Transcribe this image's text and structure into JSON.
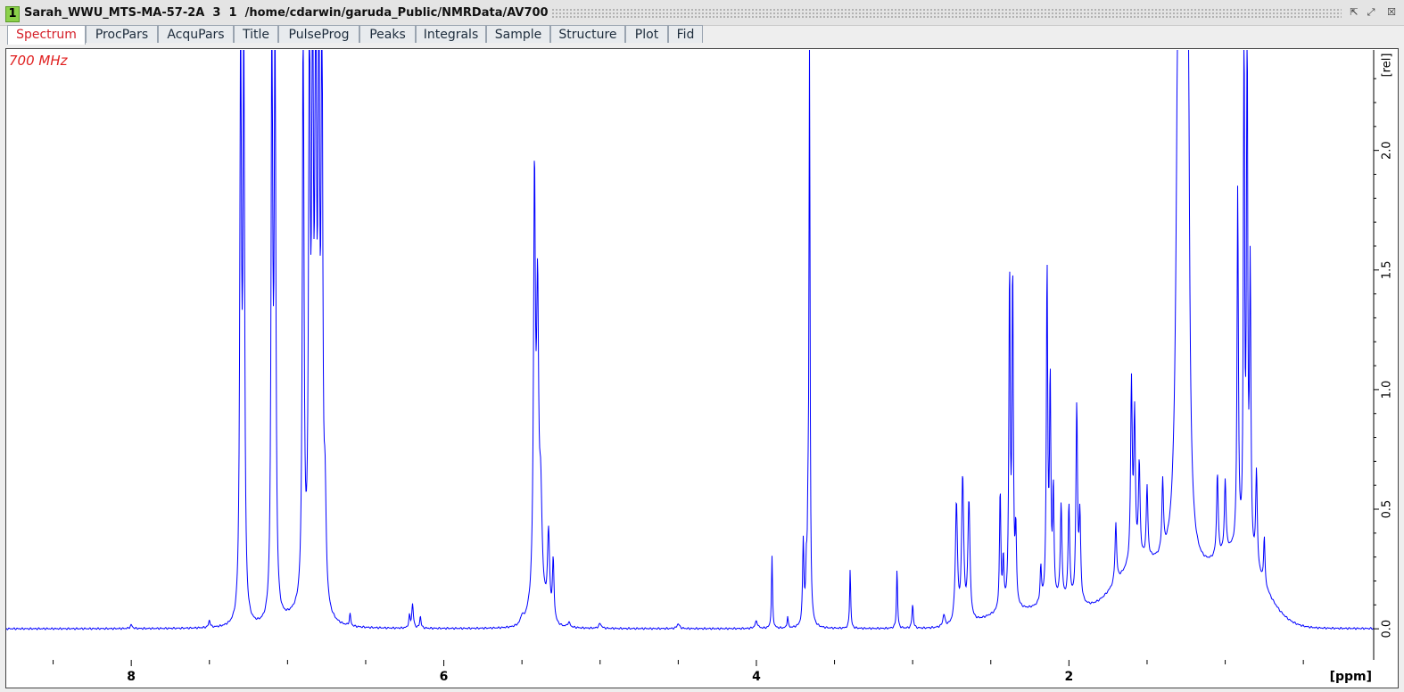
{
  "window": {
    "number": "1",
    "title": "Sarah_WWU_MTS-MA-57-2A  3  1  /home/cdarwin/garuda_Public/NMRData/AV700"
  },
  "tabs": [
    "Spectrum",
    "ProcPars",
    "AcquPars",
    "Title",
    "PulseProg",
    "Peaks",
    "Integrals",
    "Sample",
    "Structure",
    "Plot",
    "Fid"
  ],
  "active_tab": "Spectrum",
  "spectrum": {
    "frequency_label": "700 MHz",
    "color": "#0000ff"
  },
  "chart_data": {
    "type": "line",
    "xlabel": "[ppm]",
    "ylabel": "[rel]",
    "x_reversed": true,
    "xlim": [
      8.8,
      0.05
    ],
    "ylim": [
      -0.13,
      2.42
    ],
    "x_ticks": [
      {
        "value": 8,
        "label": "8"
      },
      {
        "value": 6,
        "label": "6"
      },
      {
        "value": 4,
        "label": "4"
      },
      {
        "value": 2,
        "label": "2"
      }
    ],
    "y_ticks": [
      {
        "value": 0.0,
        "label": "0.0"
      },
      {
        "value": 0.5,
        "label": "0.5"
      },
      {
        "value": 1.0,
        "label": "1.0"
      },
      {
        "value": 1.5,
        "label": "1.5"
      },
      {
        "value": 2.0,
        "label": "2.0"
      }
    ],
    "series": [
      {
        "peaks": [
          [
            8.0,
            0.015,
            0.008
          ],
          [
            7.5,
            0.03,
            0.006
          ],
          [
            7.3,
            2.5,
            0.006
          ],
          [
            7.28,
            2.5,
            0.006
          ],
          [
            7.1,
            2.5,
            0.006
          ],
          [
            7.08,
            2.5,
            0.006
          ],
          [
            6.9,
            2.5,
            0.006
          ],
          [
            6.86,
            2.5,
            0.006
          ],
          [
            6.84,
            2.5,
            0.006
          ],
          [
            6.82,
            2.5,
            0.006
          ],
          [
            6.8,
            2.5,
            0.006
          ],
          [
            6.78,
            2.5,
            0.006
          ],
          [
            6.76,
            0.4,
            0.008
          ],
          [
            6.6,
            0.05,
            0.005
          ],
          [
            6.22,
            0.05,
            0.005
          ],
          [
            6.2,
            0.1,
            0.006
          ],
          [
            6.15,
            0.05,
            0.005
          ],
          [
            5.5,
            0.03,
            0.01
          ],
          [
            5.42,
            1.74,
            0.007
          ],
          [
            5.4,
            1.2,
            0.008
          ],
          [
            5.38,
            0.4,
            0.01
          ],
          [
            5.33,
            0.35,
            0.008
          ],
          [
            5.3,
            0.25,
            0.006
          ],
          [
            5.2,
            0.02,
            0.01
          ],
          [
            5.0,
            0.02,
            0.01
          ],
          [
            4.5,
            0.02,
            0.01
          ],
          [
            4.0,
            0.03,
            0.01
          ],
          [
            3.9,
            0.3,
            0.004
          ],
          [
            3.8,
            0.05,
            0.004
          ],
          [
            3.7,
            0.35,
            0.005
          ],
          [
            3.68,
            0.2,
            0.005
          ],
          [
            3.67,
            0.3,
            0.004
          ],
          [
            3.66,
            2.5,
            0.004
          ],
          [
            3.4,
            0.25,
            0.004
          ],
          [
            3.1,
            0.25,
            0.004
          ],
          [
            3.0,
            0.1,
            0.005
          ],
          [
            2.8,
            0.05,
            0.008
          ],
          [
            2.72,
            0.5,
            0.008
          ],
          [
            2.68,
            0.6,
            0.008
          ],
          [
            2.64,
            0.5,
            0.008
          ],
          [
            2.44,
            0.5,
            0.005
          ],
          [
            2.42,
            0.2,
            0.005
          ],
          [
            2.38,
            1.4,
            0.005
          ],
          [
            2.36,
            1.38,
            0.005
          ],
          [
            2.34,
            0.3,
            0.005
          ],
          [
            2.18,
            0.15,
            0.005
          ],
          [
            2.14,
            1.4,
            0.005
          ],
          [
            2.12,
            0.9,
            0.005
          ],
          [
            2.1,
            0.45,
            0.005
          ],
          [
            2.05,
            0.4,
            0.006
          ],
          [
            2.0,
            0.4,
            0.006
          ],
          [
            1.95,
            0.82,
            0.006
          ],
          [
            1.93,
            0.35,
            0.006
          ],
          [
            1.7,
            0.25,
            0.006
          ],
          [
            1.6,
            0.75,
            0.006
          ],
          [
            1.58,
            0.6,
            0.006
          ],
          [
            1.55,
            0.4,
            0.006
          ],
          [
            1.5,
            0.3,
            0.006
          ],
          [
            1.4,
            0.3,
            0.006
          ],
          [
            1.3,
            2.1,
            0.015
          ],
          [
            1.28,
            2.5,
            0.01
          ],
          [
            1.26,
            2.5,
            0.01
          ],
          [
            1.24,
            2.5,
            0.01
          ],
          [
            1.05,
            0.35,
            0.006
          ],
          [
            1.0,
            0.3,
            0.006
          ],
          [
            0.92,
            1.5,
            0.005
          ],
          [
            0.88,
            2.5,
            0.004
          ],
          [
            0.86,
            2.5,
            0.004
          ],
          [
            0.84,
            1.2,
            0.005
          ],
          [
            0.8,
            0.4,
            0.006
          ],
          [
            0.75,
            0.2,
            0.005
          ]
        ],
        "broad_humps": [
          [
            1.3,
            0.2,
            0.25
          ],
          [
            1.6,
            0.15,
            0.15
          ],
          [
            2.05,
            0.1,
            0.15
          ],
          [
            2.4,
            0.06,
            0.15
          ],
          [
            0.9,
            0.25,
            0.15
          ],
          [
            5.4,
            0.08,
            0.05
          ],
          [
            6.9,
            0.05,
            0.1
          ]
        ]
      }
    ]
  }
}
